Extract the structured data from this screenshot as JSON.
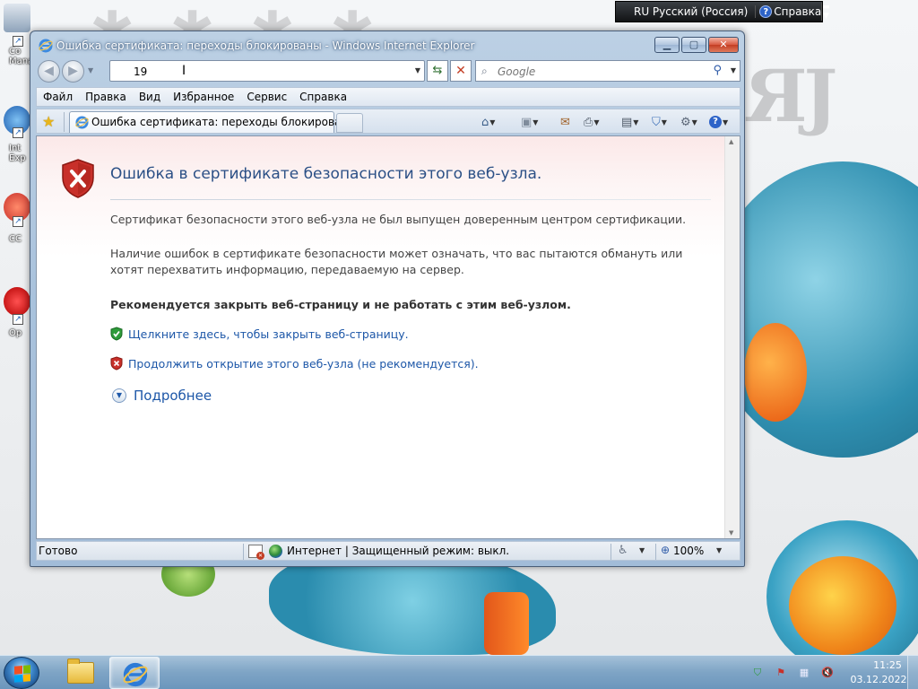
{
  "desktop": {
    "icons": [
      {
        "label": "Co\nMana"
      },
      {
        "label": "Int\nExp"
      },
      {
        "label": "CC"
      },
      {
        "label": "Op"
      }
    ]
  },
  "language_bar": {
    "language": "RU Русский (Россия)",
    "help": "Справка"
  },
  "window": {
    "title": "Ошибка сертификата: переходы блокированы - Windows Internet Explorer",
    "address_value": "19",
    "search_placeholder": "Google",
    "menu": [
      "Файл",
      "Правка",
      "Вид",
      "Избранное",
      "Сервис",
      "Справка"
    ],
    "tab_title": "Ошибка сертификата: переходы блокированы"
  },
  "page": {
    "heading": "Ошибка в сертификате безопасности этого веб-узла.",
    "paragraph1": "Сертификат безопасности этого веб-узла не был выпущен доверенным центром сертификации.",
    "paragraph2": "Наличие ошибок в сертификате безопасности может означать, что вас пытаются обмануть или хотят перехватить информацию, передаваемую на сервер.",
    "recommendation": "Рекомендуется закрыть веб-страницу и не работать с этим веб-узлом.",
    "close_link": "Щелкните здесь, чтобы закрыть веб-страницу.",
    "continue_link": "Продолжить открытие этого веб-узла (не рекомендуется).",
    "more_info": "Подробнее"
  },
  "status": {
    "text": "Готово",
    "zone": "Интернет | Защищенный режим: выкл.",
    "zoom": "100%"
  },
  "taskbar": {
    "time": "11:25",
    "date": "03.12.2022"
  },
  "colors": {
    "heading": "#2b5086",
    "link": "#1d57a8",
    "shield_red": "#c8302a",
    "shield_green": "#2e9b3a"
  }
}
